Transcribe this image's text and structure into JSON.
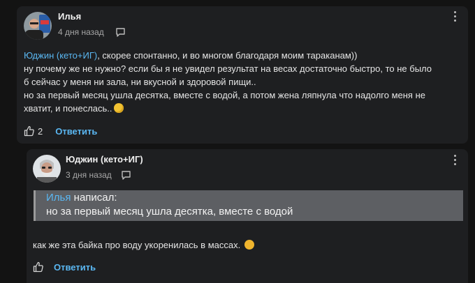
{
  "comments": [
    {
      "author": "Илья",
      "date": "4 дня назад",
      "mention": "Юджин (кето+ИГ)",
      "lines": [
        ", скорее спонтанно, и во многом благодаря моим тараканам))",
        "ну почему же не нужно? если бы я не увидел результат на весах достаточно быстро, то не было",
        "б сейчас у меня ни зала, ни вкусной и здоровой пищи..",
        "но за первый месяц ушла десятка, вместе с водой, а потом жена ляпнула что надолго меня не",
        "хватит, и понеслась.."
      ],
      "emoji": "rofl-emoji",
      "likes": "2",
      "reply_label": "Ответить"
    },
    {
      "author": "Юджин (кето+ИГ)",
      "date": "3 дня назад",
      "quote": {
        "author": "Илья",
        "verb": "написал:",
        "text": "но за первый месяц ушла десятка, вместе с водой"
      },
      "body": "как же эта байка про воду укоренилась в массах.",
      "emoji": "unamused-emoji",
      "reply_label": "Ответить"
    }
  ],
  "colors": {
    "background": "#131313",
    "card": "#1e1f21",
    "accent": "#5ab7f2",
    "quote_bg": "#5d5f63"
  }
}
